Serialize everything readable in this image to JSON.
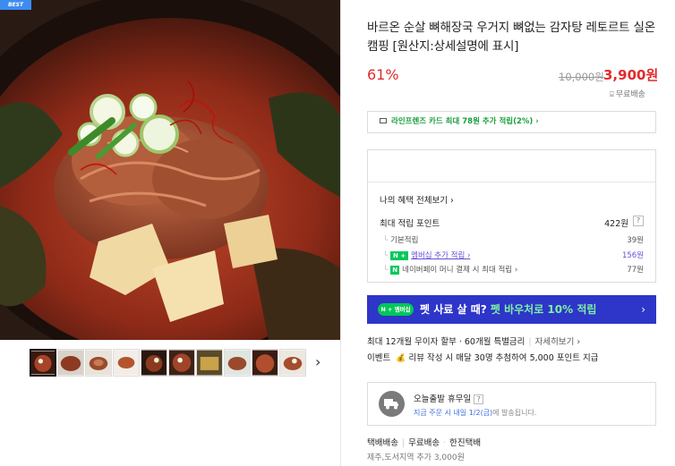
{
  "badge": "BEST",
  "product": {
    "title": "바르온 순살 뼈해장국 우거지 뼈없는 감자탕 레토르트 실온 캠핑 [원산지:상세설명에 표시]",
    "discount": "61%",
    "original_price": "10,000원",
    "sale_price": "3,900원",
    "shipping_badge": "무료배송"
  },
  "card_banner": "라인프렌즈 카드 최대 78원 추가 적립(2%) ›",
  "benefits": {
    "view_all": "나의 혜택 전체보기 ›",
    "max_label": "최대 적립 포인트",
    "max_value": "422원",
    "help": "?",
    "rows": [
      {
        "label": "기본적립",
        "value": "39원"
      },
      {
        "chip": "N +",
        "label": "멤버십 추가 적립 ›",
        "value": "156원"
      },
      {
        "chip": "N",
        "label": "네이버페이 머니 결제 시 최대 적립 ›",
        "value": "77원"
      }
    ]
  },
  "pet_banner": {
    "chip": "N + 멤버십",
    "text_a": "펫 사료 살 때? ",
    "text_b": "펫 바우처로 10% 적립",
    "arrow": "›"
  },
  "installment": {
    "text": "최대 12개월 무이자 할부 · 60개월 특별금리",
    "more": "자세히보기 ›"
  },
  "event": {
    "label": "이벤트",
    "text": "리뷰 작성 시 매달 30명 추첨하여 5,000 포인트 지급"
  },
  "shipping_info": {
    "title": "오늘출발 휴무일",
    "help": "?",
    "sub_a": "지금 주문 시 내일 1/2(금)",
    "sub_b": "에 발송됩니다."
  },
  "delivery": {
    "method": "택배배송",
    "fee": "무료배송",
    "carrier": "한진택배",
    "jeju": "제주,도서지역 추가 3,000원"
  },
  "icons": {
    "thumbs_next": "chevron-right-icon",
    "truck": "truck-icon",
    "card": "credit-card-icon"
  },
  "colors": {
    "discount_red": "#e12b2b",
    "naver_green": "#03c75a",
    "pet_blue": "#2e35c9",
    "badge_blue": "#3c8cf0"
  }
}
